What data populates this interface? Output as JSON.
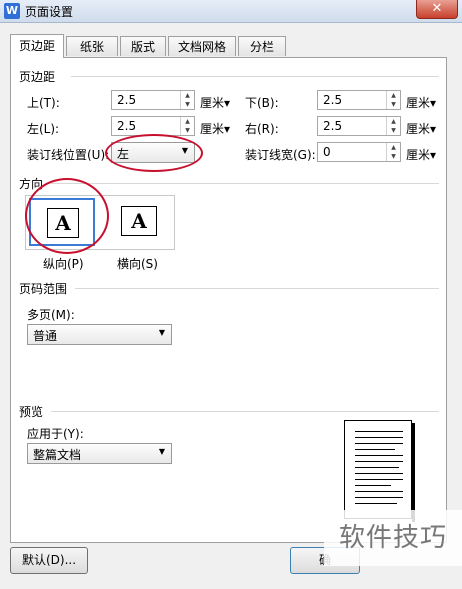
{
  "window": {
    "title": "页面设置",
    "close_label": "✕"
  },
  "tabs": [
    {
      "label": "页边距",
      "active": true
    },
    {
      "label": "纸张",
      "active": false
    },
    {
      "label": "版式",
      "active": false
    },
    {
      "label": "文档网格",
      "active": false
    },
    {
      "label": "分栏",
      "active": false
    }
  ],
  "margins": {
    "section_title": "页边距",
    "top": {
      "label": "上(T):",
      "value": "2.5",
      "unit": "厘米▾"
    },
    "bottom": {
      "label": "下(B):",
      "value": "2.5",
      "unit": "厘米▾"
    },
    "left": {
      "label": "左(L):",
      "value": "2.5",
      "unit": "厘米▾"
    },
    "right": {
      "label": "右(R):",
      "value": "2.5",
      "unit": "厘米▾"
    },
    "gutter_position": {
      "label": "装订线位置(U):",
      "value": "左"
    },
    "gutter_width": {
      "label": "装订线宽(G):",
      "value": "0",
      "unit": "厘米▾"
    }
  },
  "orientation": {
    "section_title": "方向",
    "portrait": {
      "label": "纵向(P)",
      "glyph": "A",
      "selected": true
    },
    "landscape": {
      "label": "横向(S)",
      "glyph": "A",
      "selected": false
    }
  },
  "page_range": {
    "section_title": "页码范围",
    "multiple_pages_label": "多页(M):",
    "multiple_pages_value": "普通"
  },
  "preview": {
    "section_title": "预览",
    "apply_to_label": "应用于(Y):",
    "apply_to_value": "整篇文档"
  },
  "buttons": {
    "default_label": "默认(D)...",
    "ok_label_partial": "确"
  },
  "watermark": {
    "text": "软件技巧"
  },
  "colors": {
    "annotation": "#c8102e",
    "selection": "#3a7bd5"
  }
}
